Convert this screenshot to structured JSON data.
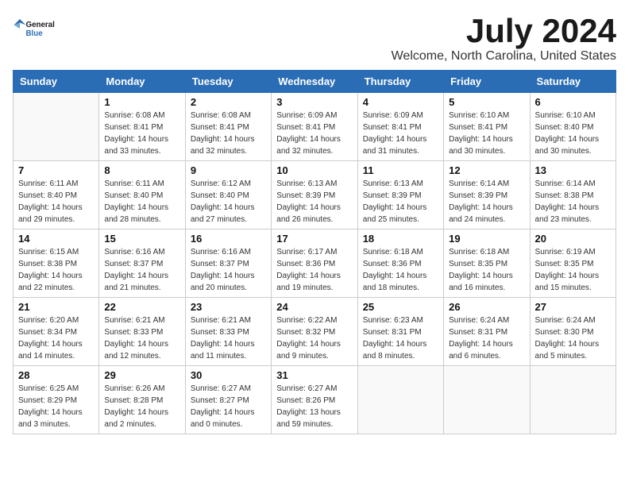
{
  "header": {
    "logo_general": "General",
    "logo_blue": "Blue",
    "month_title": "July 2024",
    "location": "Welcome, North Carolina, United States"
  },
  "days_of_week": [
    "Sunday",
    "Monday",
    "Tuesday",
    "Wednesday",
    "Thursday",
    "Friday",
    "Saturday"
  ],
  "weeks": [
    [
      {
        "day": "",
        "info": ""
      },
      {
        "day": "1",
        "info": "Sunrise: 6:08 AM\nSunset: 8:41 PM\nDaylight: 14 hours\nand 33 minutes."
      },
      {
        "day": "2",
        "info": "Sunrise: 6:08 AM\nSunset: 8:41 PM\nDaylight: 14 hours\nand 32 minutes."
      },
      {
        "day": "3",
        "info": "Sunrise: 6:09 AM\nSunset: 8:41 PM\nDaylight: 14 hours\nand 32 minutes."
      },
      {
        "day": "4",
        "info": "Sunrise: 6:09 AM\nSunset: 8:41 PM\nDaylight: 14 hours\nand 31 minutes."
      },
      {
        "day": "5",
        "info": "Sunrise: 6:10 AM\nSunset: 8:41 PM\nDaylight: 14 hours\nand 30 minutes."
      },
      {
        "day": "6",
        "info": "Sunrise: 6:10 AM\nSunset: 8:40 PM\nDaylight: 14 hours\nand 30 minutes."
      }
    ],
    [
      {
        "day": "7",
        "info": "Sunrise: 6:11 AM\nSunset: 8:40 PM\nDaylight: 14 hours\nand 29 minutes."
      },
      {
        "day": "8",
        "info": "Sunrise: 6:11 AM\nSunset: 8:40 PM\nDaylight: 14 hours\nand 28 minutes."
      },
      {
        "day": "9",
        "info": "Sunrise: 6:12 AM\nSunset: 8:40 PM\nDaylight: 14 hours\nand 27 minutes."
      },
      {
        "day": "10",
        "info": "Sunrise: 6:13 AM\nSunset: 8:39 PM\nDaylight: 14 hours\nand 26 minutes."
      },
      {
        "day": "11",
        "info": "Sunrise: 6:13 AM\nSunset: 8:39 PM\nDaylight: 14 hours\nand 25 minutes."
      },
      {
        "day": "12",
        "info": "Sunrise: 6:14 AM\nSunset: 8:39 PM\nDaylight: 14 hours\nand 24 minutes."
      },
      {
        "day": "13",
        "info": "Sunrise: 6:14 AM\nSunset: 8:38 PM\nDaylight: 14 hours\nand 23 minutes."
      }
    ],
    [
      {
        "day": "14",
        "info": "Sunrise: 6:15 AM\nSunset: 8:38 PM\nDaylight: 14 hours\nand 22 minutes."
      },
      {
        "day": "15",
        "info": "Sunrise: 6:16 AM\nSunset: 8:37 PM\nDaylight: 14 hours\nand 21 minutes."
      },
      {
        "day": "16",
        "info": "Sunrise: 6:16 AM\nSunset: 8:37 PM\nDaylight: 14 hours\nand 20 minutes."
      },
      {
        "day": "17",
        "info": "Sunrise: 6:17 AM\nSunset: 8:36 PM\nDaylight: 14 hours\nand 19 minutes."
      },
      {
        "day": "18",
        "info": "Sunrise: 6:18 AM\nSunset: 8:36 PM\nDaylight: 14 hours\nand 18 minutes."
      },
      {
        "day": "19",
        "info": "Sunrise: 6:18 AM\nSunset: 8:35 PM\nDaylight: 14 hours\nand 16 minutes."
      },
      {
        "day": "20",
        "info": "Sunrise: 6:19 AM\nSunset: 8:35 PM\nDaylight: 14 hours\nand 15 minutes."
      }
    ],
    [
      {
        "day": "21",
        "info": "Sunrise: 6:20 AM\nSunset: 8:34 PM\nDaylight: 14 hours\nand 14 minutes."
      },
      {
        "day": "22",
        "info": "Sunrise: 6:21 AM\nSunset: 8:33 PM\nDaylight: 14 hours\nand 12 minutes."
      },
      {
        "day": "23",
        "info": "Sunrise: 6:21 AM\nSunset: 8:33 PM\nDaylight: 14 hours\nand 11 minutes."
      },
      {
        "day": "24",
        "info": "Sunrise: 6:22 AM\nSunset: 8:32 PM\nDaylight: 14 hours\nand 9 minutes."
      },
      {
        "day": "25",
        "info": "Sunrise: 6:23 AM\nSunset: 8:31 PM\nDaylight: 14 hours\nand 8 minutes."
      },
      {
        "day": "26",
        "info": "Sunrise: 6:24 AM\nSunset: 8:31 PM\nDaylight: 14 hours\nand 6 minutes."
      },
      {
        "day": "27",
        "info": "Sunrise: 6:24 AM\nSunset: 8:30 PM\nDaylight: 14 hours\nand 5 minutes."
      }
    ],
    [
      {
        "day": "28",
        "info": "Sunrise: 6:25 AM\nSunset: 8:29 PM\nDaylight: 14 hours\nand 3 minutes."
      },
      {
        "day": "29",
        "info": "Sunrise: 6:26 AM\nSunset: 8:28 PM\nDaylight: 14 hours\nand 2 minutes."
      },
      {
        "day": "30",
        "info": "Sunrise: 6:27 AM\nSunset: 8:27 PM\nDaylight: 14 hours\nand 0 minutes."
      },
      {
        "day": "31",
        "info": "Sunrise: 6:27 AM\nSunset: 8:26 PM\nDaylight: 13 hours\nand 59 minutes."
      },
      {
        "day": "",
        "info": ""
      },
      {
        "day": "",
        "info": ""
      },
      {
        "day": "",
        "info": ""
      }
    ]
  ]
}
